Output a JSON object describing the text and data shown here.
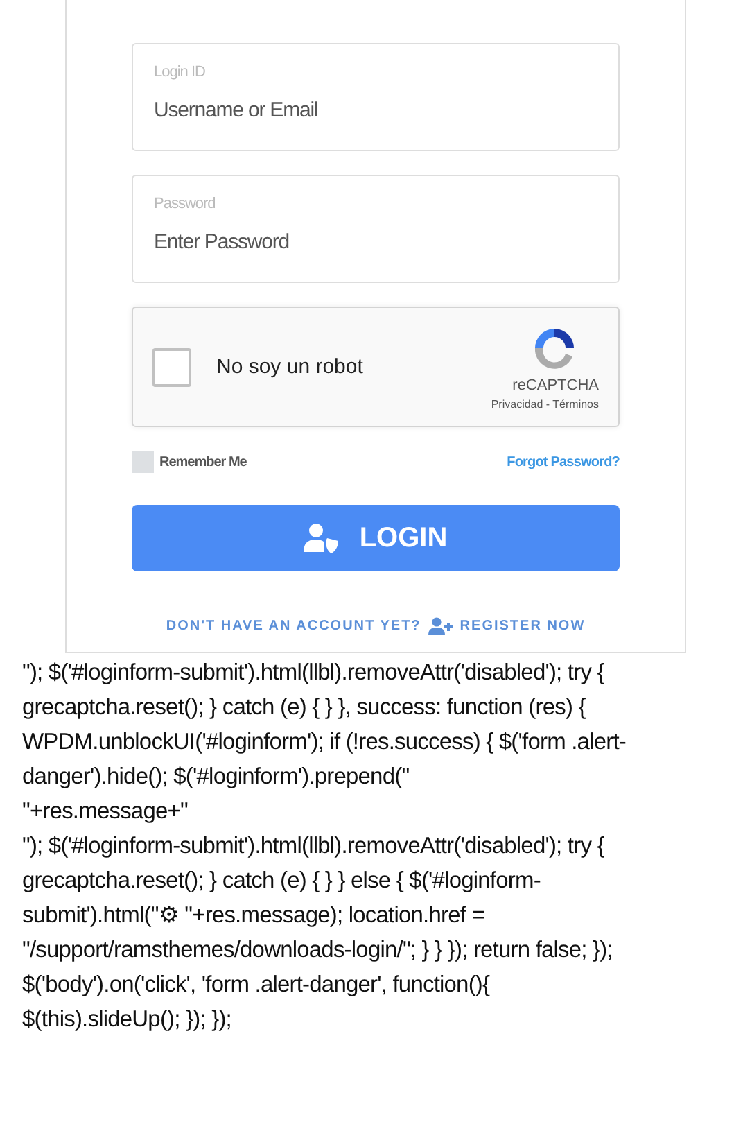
{
  "login_form": {
    "fields": [
      {
        "label": "Login ID",
        "placeholder": "Username or Email"
      },
      {
        "label": "Password",
        "placeholder": "Enter Password"
      }
    ],
    "captcha": {
      "checked": false,
      "label": "No soy un robot",
      "brand": "reCAPTCHA",
      "links": "Privacidad - Términos"
    },
    "remember_me": {
      "label": "Remember Me",
      "checked": false
    },
    "forgot_link": "Forgot Password?",
    "login_button": "LOGIN",
    "register": {
      "prompt": "DON'T HAVE AN ACCOUNT YET?",
      "link": "REGISTER NOW"
    }
  },
  "code_lines": [
    "\"); $('#loginform-submit').html(llbl).removeAttr('disabled'); try {",
    "grecaptcha.reset(); } catch (e) { } }, success: function (res) {",
    "WPDM.unblockUI('#loginform'); if (!res.success) { $('form .alert-",
    "danger').hide(); $('#loginform').prepend(\"",
    "\"+res.message+\"",
    "\"); $('#loginform-submit').html(llbl).removeAttr('disabled'); try {",
    "grecaptcha.reset(); } catch (e) { } } else { $('#loginform-",
    "submit').html(\"⚙ \"+res.message); location.href =",
    "\"/support/ramsthemes/downloads-login/\"; } } }); return false; });",
    "$('body').on('click', 'form .alert-danger', function(){",
    "$(this).slideUp(); }); });"
  ]
}
